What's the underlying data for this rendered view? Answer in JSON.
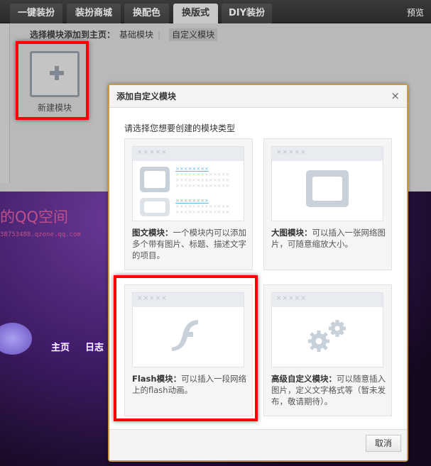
{
  "topbar": {
    "tabs": [
      "一键装扮",
      "装扮商城",
      "换配色",
      "换版式",
      "DIY装扮"
    ],
    "active_tab": "换版式",
    "preview": "预览"
  },
  "subheader": {
    "label": "选择模块添加到主页：",
    "options": [
      "基础模块",
      "自定义模块"
    ],
    "selected": "自定义模块"
  },
  "new_module": {
    "label": "新建模块"
  },
  "background": {
    "title": "的QQ空间",
    "url": "38753488.qzone.qq.com",
    "nav": [
      "主页",
      "日志"
    ]
  },
  "dialog": {
    "title": "添加自定义模块",
    "close": "×",
    "intro": "请选择您想要创建的模块类型",
    "placeholder_header": "×××××",
    "placeholder_link": "××××××××",
    "placeholder_text": "×××××××××××××",
    "cards": [
      {
        "name": "图文模块：",
        "desc": "一个模块内可以添加多个带有图片、标题、描述文字的项目。",
        "icon": "image-text-icon"
      },
      {
        "name": "大图模块：",
        "desc": "可以插入一张网络图片，可随意缩放大小。",
        "icon": "image-icon"
      },
      {
        "name": "Flash模块：",
        "desc": "可以插入一段网络上的flash动画。",
        "icon": "flash-icon"
      },
      {
        "name": "高级自定义模块：",
        "desc": "可以随意插入图片，定义文字格式等（暂未发布，敬请期待）。",
        "icon": "gears-icon"
      }
    ],
    "cancel": "取消"
  },
  "colors": {
    "highlight": "#ff0000",
    "dialog_border": "#c89a4a"
  }
}
